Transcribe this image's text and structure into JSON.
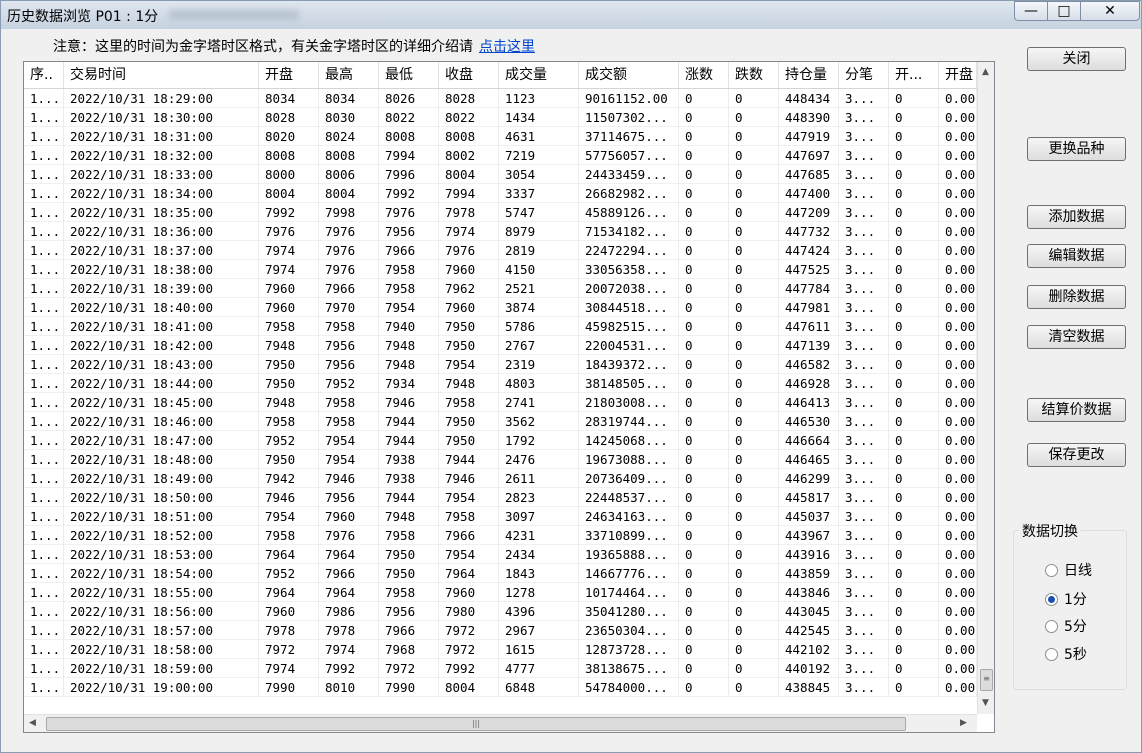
{
  "window": {
    "title": "历史数据浏览 P01 : 1分",
    "min_label": "—",
    "max_label": "□",
    "close_label": "✕"
  },
  "notice": {
    "text": "注意：这里的时间为金字塔时区格式，有关金字塔时区的详细介绍请",
    "link": "点击这里"
  },
  "table": {
    "headers": [
      "序..",
      "交易时间",
      "开盘",
      "最高",
      "最低",
      "收盘",
      "成交量",
      "成交额",
      "涨数",
      "跌数",
      "持仓量",
      "分笔",
      "开...",
      "开盘"
    ],
    "rows": [
      [
        "1...",
        "2022/10/31 18:29:00",
        "8034",
        "8034",
        "8026",
        "8028",
        "1123",
        "90161152.00",
        "0",
        "0",
        "448434",
        "3...",
        "0",
        "0.00"
      ],
      [
        "1...",
        "2022/10/31 18:30:00",
        "8028",
        "8030",
        "8022",
        "8022",
        "1434",
        "11507302...",
        "0",
        "0",
        "448390",
        "3...",
        "0",
        "0.00"
      ],
      [
        "1...",
        "2022/10/31 18:31:00",
        "8020",
        "8024",
        "8008",
        "8008",
        "4631",
        "37114675...",
        "0",
        "0",
        "447919",
        "3...",
        "0",
        "0.00"
      ],
      [
        "1...",
        "2022/10/31 18:32:00",
        "8008",
        "8008",
        "7994",
        "8002",
        "7219",
        "57756057...",
        "0",
        "0",
        "447697",
        "3...",
        "0",
        "0.00"
      ],
      [
        "1...",
        "2022/10/31 18:33:00",
        "8000",
        "8006",
        "7996",
        "8004",
        "3054",
        "24433459...",
        "0",
        "0",
        "447685",
        "3...",
        "0",
        "0.00"
      ],
      [
        "1...",
        "2022/10/31 18:34:00",
        "8004",
        "8004",
        "7992",
        "7994",
        "3337",
        "26682982...",
        "0",
        "0",
        "447400",
        "3...",
        "0",
        "0.00"
      ],
      [
        "1...",
        "2022/10/31 18:35:00",
        "7992",
        "7998",
        "7976",
        "7978",
        "5747",
        "45889126...",
        "0",
        "0",
        "447209",
        "3...",
        "0",
        "0.00"
      ],
      [
        "1...",
        "2022/10/31 18:36:00",
        "7976",
        "7976",
        "7956",
        "7974",
        "8979",
        "71534182...",
        "0",
        "0",
        "447732",
        "3...",
        "0",
        "0.00"
      ],
      [
        "1...",
        "2022/10/31 18:37:00",
        "7974",
        "7976",
        "7966",
        "7976",
        "2819",
        "22472294...",
        "0",
        "0",
        "447424",
        "3...",
        "0",
        "0.00"
      ],
      [
        "1...",
        "2022/10/31 18:38:00",
        "7974",
        "7976",
        "7958",
        "7960",
        "4150",
        "33056358...",
        "0",
        "0",
        "447525",
        "3...",
        "0",
        "0.00"
      ],
      [
        "1...",
        "2022/10/31 18:39:00",
        "7960",
        "7966",
        "7958",
        "7962",
        "2521",
        "20072038...",
        "0",
        "0",
        "447784",
        "3...",
        "0",
        "0.00"
      ],
      [
        "1...",
        "2022/10/31 18:40:00",
        "7960",
        "7970",
        "7954",
        "7960",
        "3874",
        "30844518...",
        "0",
        "0",
        "447981",
        "3...",
        "0",
        "0.00"
      ],
      [
        "1...",
        "2022/10/31 18:41:00",
        "7958",
        "7958",
        "7940",
        "7950",
        "5786",
        "45982515...",
        "0",
        "0",
        "447611",
        "3...",
        "0",
        "0.00"
      ],
      [
        "1...",
        "2022/10/31 18:42:00",
        "7948",
        "7956",
        "7948",
        "7950",
        "2767",
        "22004531...",
        "0",
        "0",
        "447139",
        "3...",
        "0",
        "0.00"
      ],
      [
        "1...",
        "2022/10/31 18:43:00",
        "7950",
        "7956",
        "7948",
        "7954",
        "2319",
        "18439372...",
        "0",
        "0",
        "446582",
        "3...",
        "0",
        "0.00"
      ],
      [
        "1...",
        "2022/10/31 18:44:00",
        "7950",
        "7952",
        "7934",
        "7948",
        "4803",
        "38148505...",
        "0",
        "0",
        "446928",
        "3...",
        "0",
        "0.00"
      ],
      [
        "1...",
        "2022/10/31 18:45:00",
        "7948",
        "7958",
        "7946",
        "7958",
        "2741",
        "21803008...",
        "0",
        "0",
        "446413",
        "3...",
        "0",
        "0.00"
      ],
      [
        "1...",
        "2022/10/31 18:46:00",
        "7958",
        "7958",
        "7944",
        "7950",
        "3562",
        "28319744...",
        "0",
        "0",
        "446530",
        "3...",
        "0",
        "0.00"
      ],
      [
        "1...",
        "2022/10/31 18:47:00",
        "7952",
        "7954",
        "7944",
        "7950",
        "1792",
        "14245068...",
        "0",
        "0",
        "446664",
        "3...",
        "0",
        "0.00"
      ],
      [
        "1...",
        "2022/10/31 18:48:00",
        "7950",
        "7954",
        "7938",
        "7944",
        "2476",
        "19673088...",
        "0",
        "0",
        "446465",
        "3...",
        "0",
        "0.00"
      ],
      [
        "1...",
        "2022/10/31 18:49:00",
        "7942",
        "7946",
        "7938",
        "7946",
        "2611",
        "20736409...",
        "0",
        "0",
        "446299",
        "3...",
        "0",
        "0.00"
      ],
      [
        "1...",
        "2022/10/31 18:50:00",
        "7946",
        "7956",
        "7944",
        "7954",
        "2823",
        "22448537...",
        "0",
        "0",
        "445817",
        "3...",
        "0",
        "0.00"
      ],
      [
        "1...",
        "2022/10/31 18:51:00",
        "7954",
        "7960",
        "7948",
        "7958",
        "3097",
        "24634163...",
        "0",
        "0",
        "445037",
        "3...",
        "0",
        "0.00"
      ],
      [
        "1...",
        "2022/10/31 18:52:00",
        "7958",
        "7976",
        "7958",
        "7966",
        "4231",
        "33710899...",
        "0",
        "0",
        "443967",
        "3...",
        "0",
        "0.00"
      ],
      [
        "1...",
        "2022/10/31 18:53:00",
        "7964",
        "7964",
        "7950",
        "7954",
        "2434",
        "19365888...",
        "0",
        "0",
        "443916",
        "3...",
        "0",
        "0.00"
      ],
      [
        "1...",
        "2022/10/31 18:54:00",
        "7952",
        "7966",
        "7950",
        "7964",
        "1843",
        "14667776...",
        "0",
        "0",
        "443859",
        "3...",
        "0",
        "0.00"
      ],
      [
        "1...",
        "2022/10/31 18:55:00",
        "7964",
        "7964",
        "7958",
        "7960",
        "1278",
        "10174464...",
        "0",
        "0",
        "443846",
        "3...",
        "0",
        "0.00"
      ],
      [
        "1...",
        "2022/10/31 18:56:00",
        "7960",
        "7986",
        "7956",
        "7980",
        "4396",
        "35041280...",
        "0",
        "0",
        "443045",
        "3...",
        "0",
        "0.00"
      ],
      [
        "1...",
        "2022/10/31 18:57:00",
        "7978",
        "7978",
        "7966",
        "7972",
        "2967",
        "23650304...",
        "0",
        "0",
        "442545",
        "3...",
        "0",
        "0.00"
      ],
      [
        "1...",
        "2022/10/31 18:58:00",
        "7972",
        "7974",
        "7968",
        "7972",
        "1615",
        "12873728...",
        "0",
        "0",
        "442102",
        "3...",
        "0",
        "0.00"
      ],
      [
        "1...",
        "2022/10/31 18:59:00",
        "7974",
        "7992",
        "7972",
        "7992",
        "4777",
        "38138675...",
        "0",
        "0",
        "440192",
        "3...",
        "0",
        "0.00"
      ],
      [
        "1...",
        "2022/10/31 19:00:00",
        "7990",
        "8010",
        "7990",
        "8004",
        "6848",
        "54784000...",
        "0",
        "0",
        "438845",
        "3...",
        "0",
        "0.00"
      ]
    ]
  },
  "buttons": {
    "close": "关闭",
    "change_symbol": "更换品种",
    "add": "添加数据",
    "edit": "编辑数据",
    "delete": "删除数据",
    "clear": "清空数据",
    "settlement": "结算价数据",
    "save": "保存更改"
  },
  "data_switch": {
    "title": "数据切换",
    "options": [
      "日线",
      "1分",
      "5分",
      "5秒"
    ],
    "selected": "1分"
  }
}
